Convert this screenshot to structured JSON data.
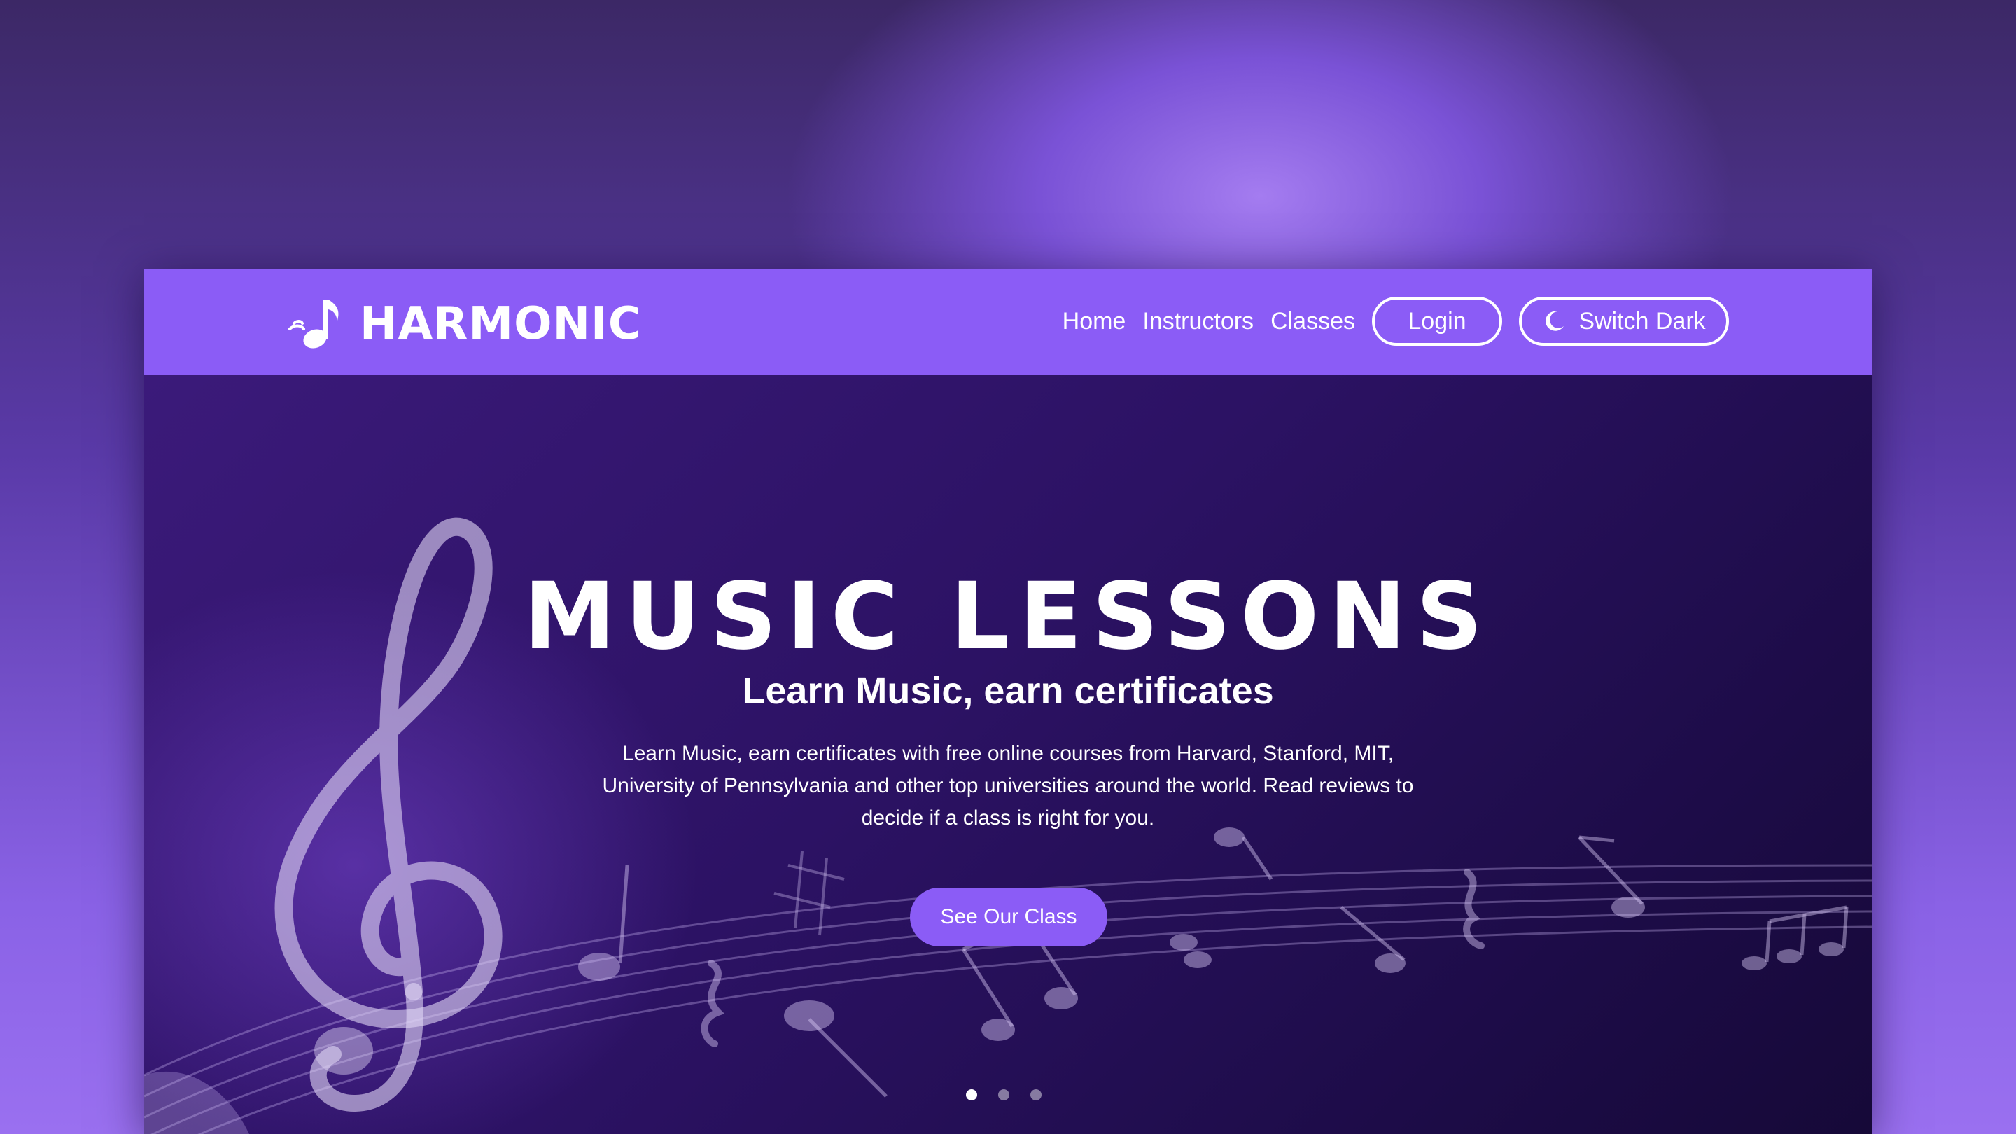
{
  "brand": {
    "name": "HARMONIC",
    "logo_icon": "music-note-icon"
  },
  "nav": {
    "links": [
      "Home",
      "Instructors",
      "Classes"
    ],
    "login_label": "Login",
    "switch_dark_label": "Switch Dark",
    "switch_dark_icon": "moon-icon"
  },
  "hero": {
    "title": "MUSIC LESSONS",
    "subtitle": "Learn Music, earn certificates",
    "description": "Learn Music, earn certificates with free online courses from Harvard, Stanford, MIT, University of Pennsylvania and other top universities around the world. Read reviews to decide if a class is right for you.",
    "cta_label": "See Our Class",
    "background_art": [
      "treble-clef-icon",
      "music-staff-notes"
    ],
    "carousel": {
      "slides": 3,
      "active_index": 0
    }
  },
  "colors": {
    "accent": "#8b5cf6",
    "hero_dark": "#1d0c48",
    "text": "#ffffff"
  }
}
